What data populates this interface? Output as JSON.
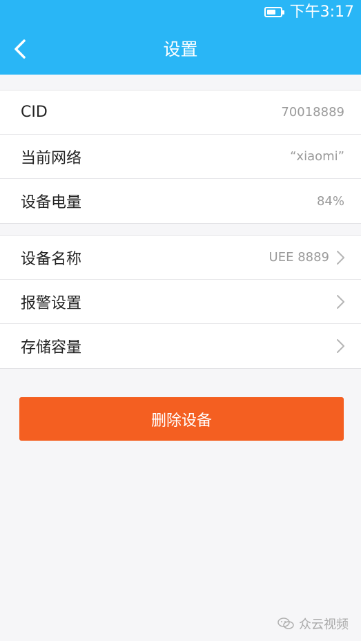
{
  "status_bar": {
    "time": "下午3:17"
  },
  "header": {
    "title": "设置"
  },
  "info_group": [
    {
      "label": "CID",
      "value": "70018889"
    },
    {
      "label": "当前网络",
      "value": "“xiaomi”"
    },
    {
      "label": "设备电量",
      "value": "84%"
    }
  ],
  "settings_group": [
    {
      "label": "设备名称",
      "value": "UEE 8889"
    },
    {
      "label": "报警设置",
      "value": ""
    },
    {
      "label": "存储容量",
      "value": ""
    }
  ],
  "delete_button": {
    "label": "删除设备"
  },
  "watermark": {
    "text": "众云视频"
  },
  "colors": {
    "header": "#29b6f6",
    "delete_button": "#f45f21",
    "background": "#f6f6f8"
  },
  "icons": [
    "back-arrow-icon",
    "battery-icon",
    "chevron-right-icon",
    "wechat-icon"
  ]
}
